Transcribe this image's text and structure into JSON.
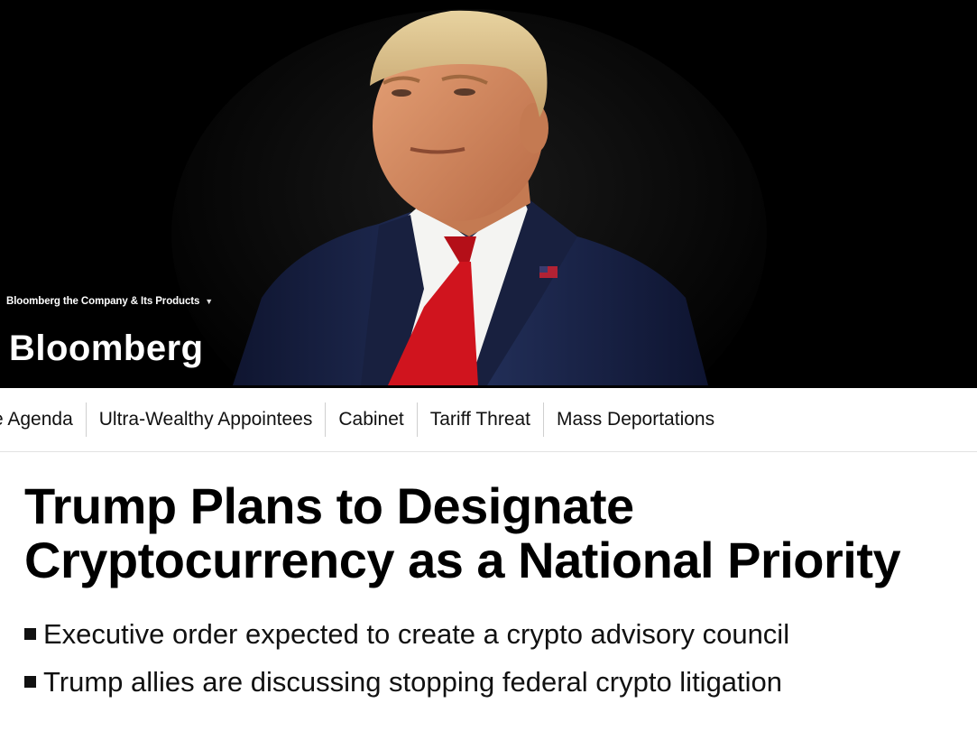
{
  "header": {
    "company_menu_label": "Bloomberg the Company & Its Products",
    "company_menu_icon": "caret-down-icon",
    "logo_text": "Bloomberg",
    "hero_image": "portrait of Donald Trump in navy suit, white shirt and red tie with flag pin against black background"
  },
  "nav": {
    "items": [
      {
        "label": "e Agenda"
      },
      {
        "label": "Ultra-Wealthy Appointees"
      },
      {
        "label": "Cabinet"
      },
      {
        "label": "Tariff Threat"
      },
      {
        "label": "Mass Deportations"
      }
    ]
  },
  "article": {
    "headline": "Trump Plans to Designate Cryptocurrency as a National Priority",
    "bullets": [
      "Executive order expected to create a crypto advisory council",
      "Trump allies are discussing stopping federal crypto litigation"
    ]
  },
  "colors": {
    "hero_background": "#000000",
    "tie_red": "#c8121a",
    "suit_navy": "#1b2240",
    "text": "#111111"
  }
}
